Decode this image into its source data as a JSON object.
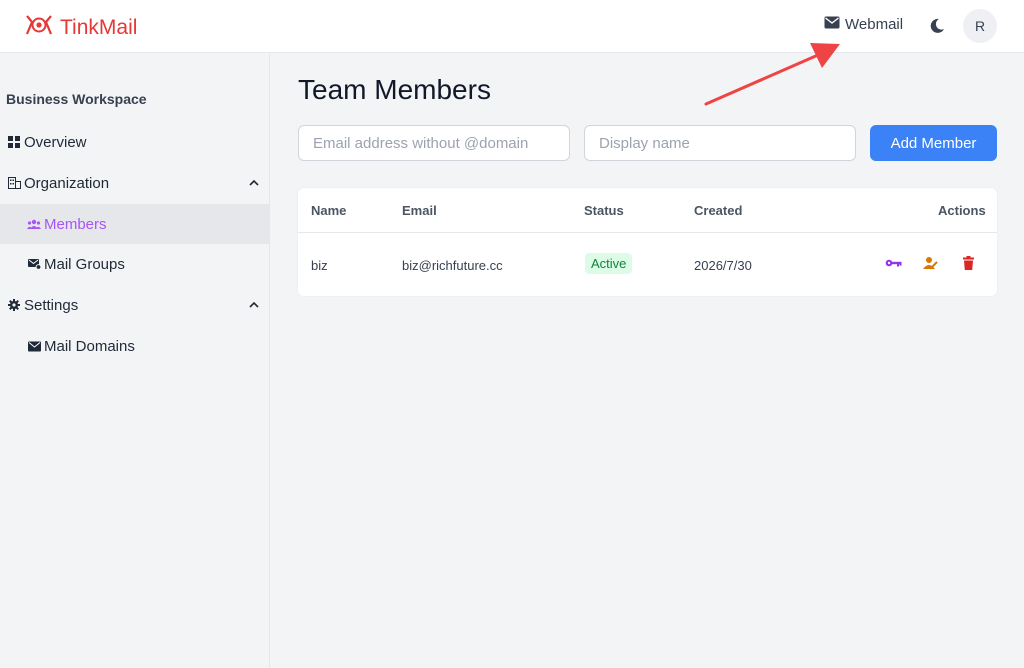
{
  "app": {
    "name": "TinkMail"
  },
  "header": {
    "webmail_label": "Webmail",
    "avatar_initial": "R"
  },
  "sidebar": {
    "workspace_title": "Business Workspace",
    "items": [
      {
        "label": "Overview"
      },
      {
        "label": "Organization"
      },
      {
        "label": "Members"
      },
      {
        "label": "Mail Groups"
      },
      {
        "label": "Settings"
      },
      {
        "label": "Mail Domains"
      }
    ]
  },
  "main": {
    "title": "Team Members",
    "email_placeholder": "Email address without @domain",
    "name_placeholder": "Display name",
    "add_button": "Add Member",
    "table": {
      "headers": {
        "name": "Name",
        "email": "Email",
        "status": "Status",
        "created": "Created",
        "actions": "Actions"
      },
      "rows": [
        {
          "name": "biz",
          "email": "biz@richfuture.cc",
          "status": "Active",
          "created": "2026/7/30"
        }
      ]
    }
  },
  "colors": {
    "brand": "#e53935",
    "accent": "#3b82f6",
    "active_nav": "#a855f7",
    "annotation_arrow": "#ef4444"
  },
  "icons": [
    "logo-icon",
    "mail-icon",
    "moon-icon",
    "grid-icon",
    "building-icon",
    "users-icon",
    "mail-group-icon",
    "gear-icon",
    "mail-domain-icon",
    "chevron-up-icon",
    "key-icon",
    "user-edit-icon",
    "trash-icon"
  ]
}
